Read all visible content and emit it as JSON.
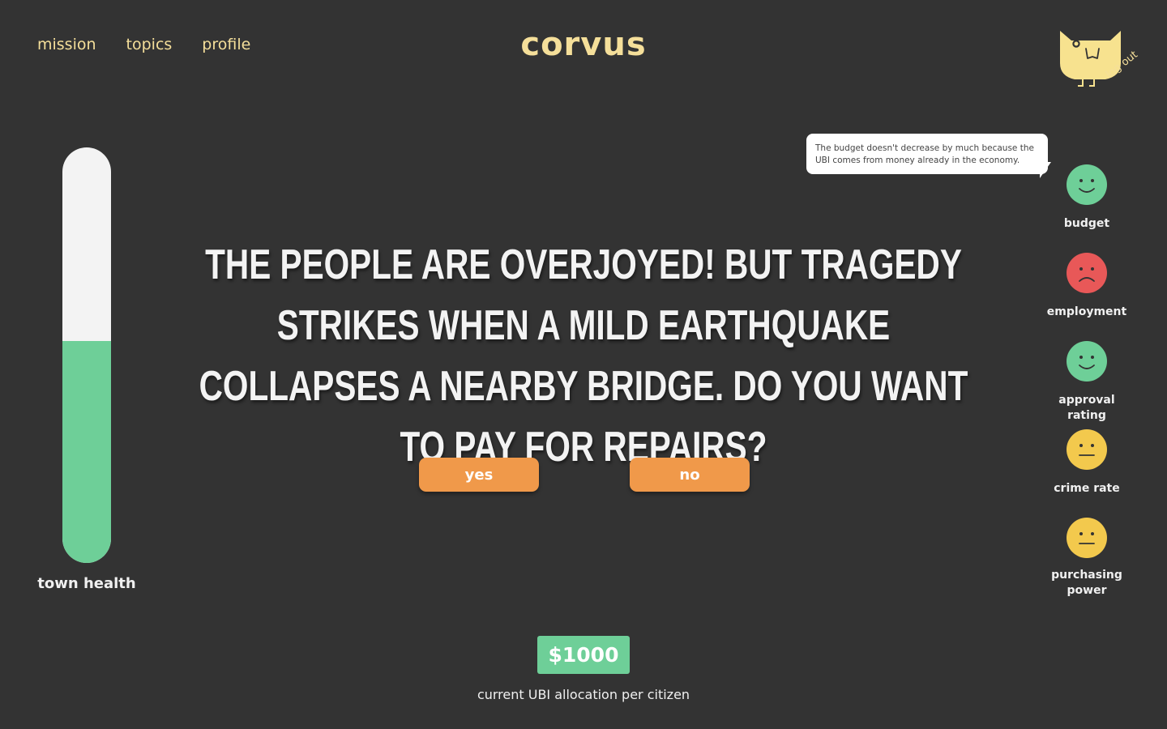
{
  "nav": {
    "items": [
      {
        "label": "mission"
      },
      {
        "label": "topics"
      },
      {
        "label": "profile"
      }
    ]
  },
  "brand": {
    "title": "corvus"
  },
  "account": {
    "logout_label": "log out",
    "avatar_icon": "owl-icon"
  },
  "health": {
    "label": "town health",
    "level_fraction": 0.535
  },
  "question": {
    "text": "The people are overjoyed! But tragedy strikes when a mild earthquake collapses a nearby bridge. Do you want to pay for repairs?"
  },
  "actions": {
    "yes_label": "yes",
    "no_label": "no"
  },
  "ubi": {
    "amount": "$1000",
    "caption": "current UBI allocation per citizen"
  },
  "tooltip": {
    "text": "The budget doesn't decrease by much because the UBI comes from money already in the economy."
  },
  "metrics": [
    {
      "label": "budget",
      "mood": "happy",
      "color": "#6ecf98",
      "icon": "happy-face-icon"
    },
    {
      "label": "employment",
      "mood": "sad",
      "color": "#e85858",
      "icon": "sad-face-icon"
    },
    {
      "label": "approval rating",
      "mood": "happy",
      "color": "#6ecf98",
      "icon": "happy-face-icon"
    },
    {
      "label": "crime rate",
      "mood": "neutral",
      "color": "#f3c94d",
      "icon": "neutral-face-icon"
    },
    {
      "label": "purchasing power",
      "mood": "neutral",
      "color": "#f3c94d",
      "icon": "neutral-face-icon"
    }
  ],
  "colors": {
    "background": "#333333",
    "accent_yellow": "#f5df9a",
    "button_orange": "#f0994a",
    "green": "#6ecf98",
    "red": "#e85858",
    "neutral_yellow": "#f3c94d"
  }
}
